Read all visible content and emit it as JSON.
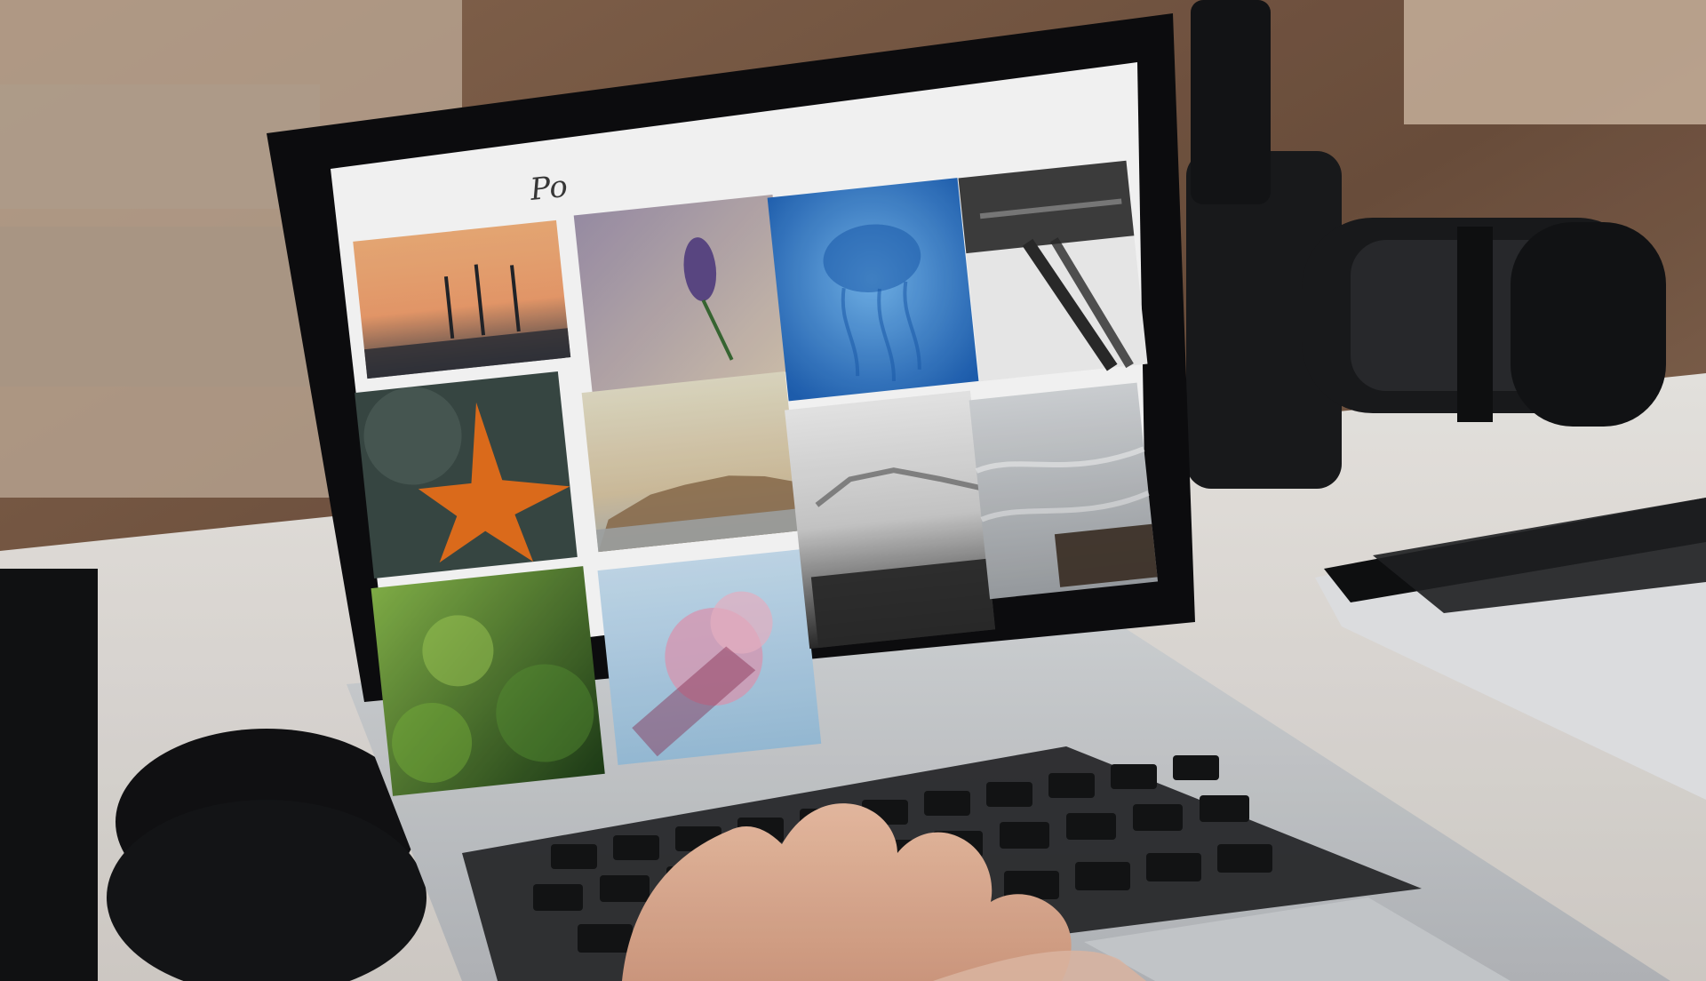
{
  "scene": {
    "description_type": "photo",
    "subject": "laptop-on-desk",
    "colors": {
      "wall": "#7a5a45",
      "desk": "#e8e3de",
      "laptop_body": "#c9cccf",
      "bezel": "#0d0d0f",
      "screen_bg": "#ffffff",
      "keys": "#161719",
      "skin": "#e2b49a",
      "camera": "#1a1b1d",
      "tablet": "#dfe1e3"
    }
  },
  "screen": {
    "logo_text": "Po",
    "gallery": [
      {
        "name": "sunset-sailboats",
        "colors": [
          "#f0a070",
          "#6a5070",
          "#3d3f48"
        ]
      },
      {
        "name": "purple-flower",
        "colors": [
          "#b7a9b8",
          "#6b5e8e",
          "#d0c0b0"
        ]
      },
      {
        "name": "jellyfish",
        "colors": [
          "#3a8ed8",
          "#1f62b6",
          "#7fc0f0"
        ]
      },
      {
        "name": "bridge-structure",
        "colors": [
          "#f4f4f4",
          "#2b2b2b",
          "#9a9a9a"
        ]
      },
      {
        "name": "starfish",
        "colors": [
          "#2e3a38",
          "#e8711d",
          "#6a7a72"
        ]
      },
      {
        "name": "coastal-town",
        "colors": [
          "#d9cfb5",
          "#8d6f4d",
          "#9ca0a0"
        ]
      },
      {
        "name": "foggy-village",
        "colors": [
          "#d8d8d8",
          "#4a4a4a",
          "#2b2b2b"
        ]
      },
      {
        "name": "ocean-rock",
        "colors": [
          "#d9dcdf",
          "#a6aaae",
          "#3c2f24"
        ]
      },
      {
        "name": "green-leaves",
        "colors": [
          "#3c7a2a",
          "#93c24a",
          "#1d3a18"
        ]
      },
      {
        "name": "pink-blossom",
        "colors": [
          "#bfd8ec",
          "#e89ab6",
          "#8d2e55"
        ]
      }
    ]
  }
}
